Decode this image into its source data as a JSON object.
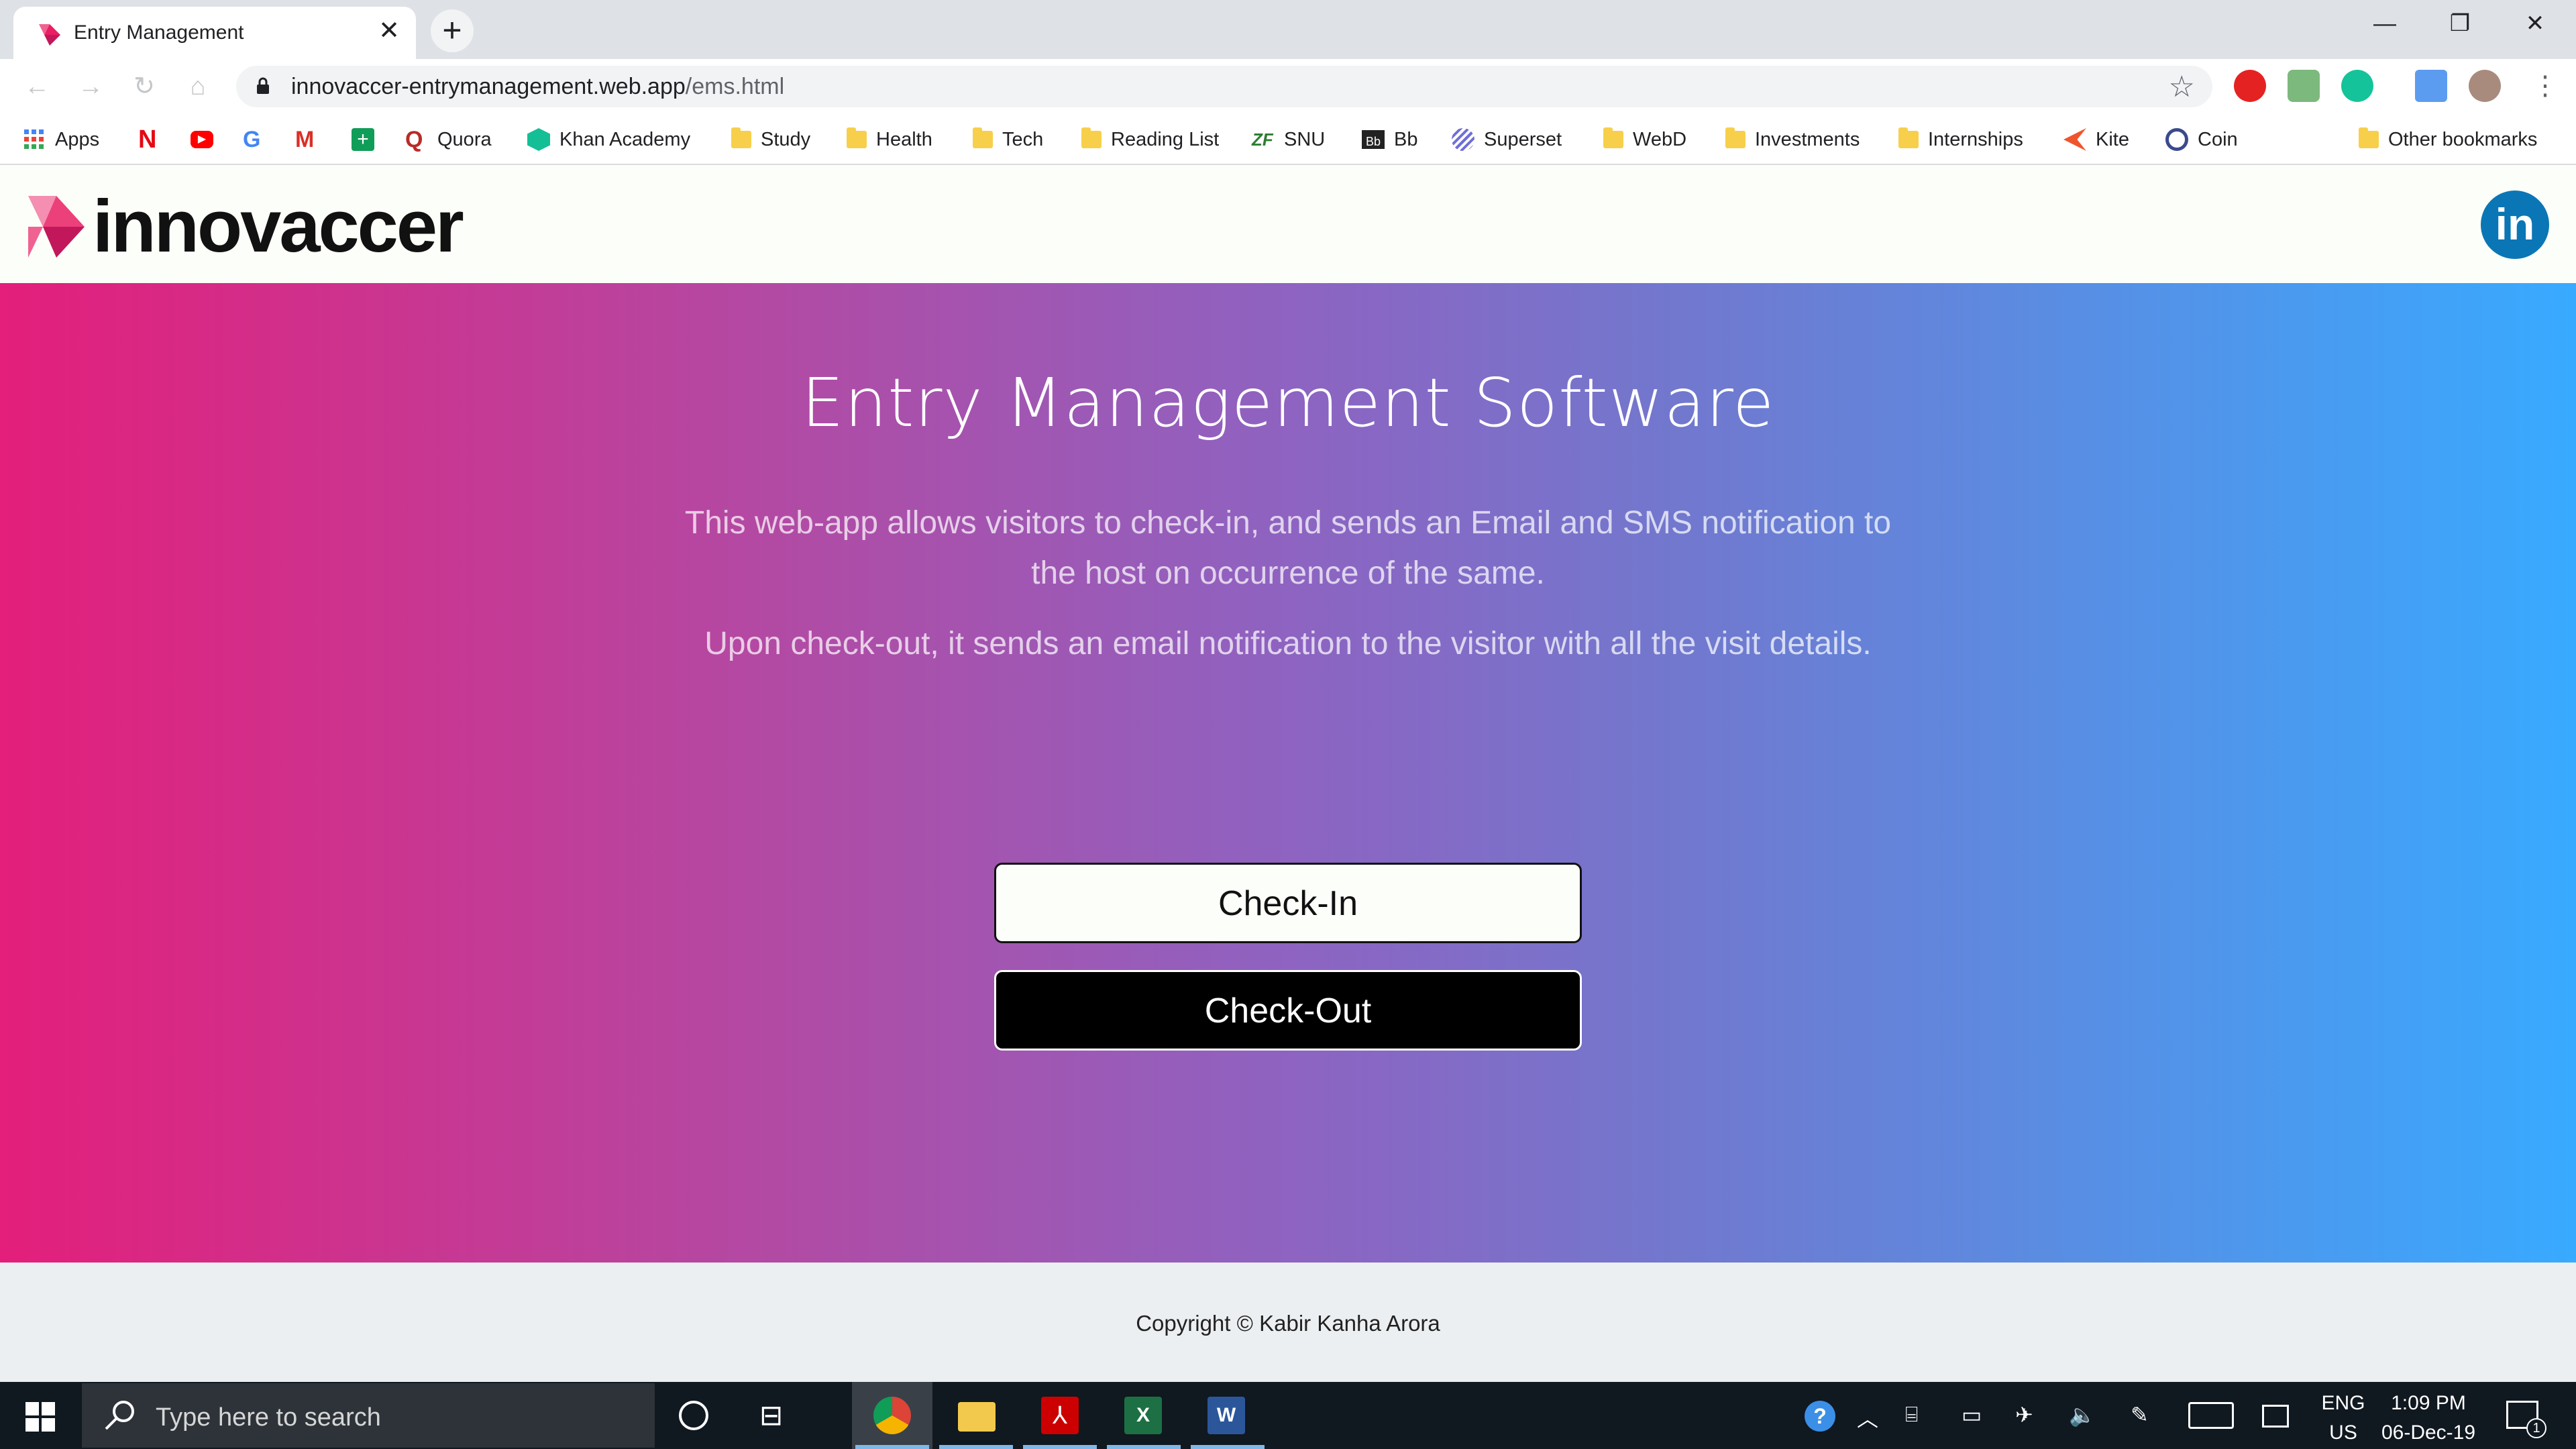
{
  "browser": {
    "tab_title": "Entry Management",
    "url_host": "innovaccer-entrymanagement.web.app",
    "url_path": "/ems.html"
  },
  "bookmarks": [
    {
      "label": "Apps",
      "icon": "apps-grid-icon"
    },
    {
      "label": "",
      "icon": "netflix-icon"
    },
    {
      "label": "",
      "icon": "youtube-icon"
    },
    {
      "label": "",
      "icon": "google-icon"
    },
    {
      "label": "",
      "icon": "gmail-icon"
    },
    {
      "label": "",
      "icon": "sheets-icon"
    },
    {
      "label": "Quora",
      "icon": "quora-icon"
    },
    {
      "label": "Khan Academy",
      "icon": "khan-academy-icon"
    },
    {
      "label": "Study",
      "icon": "folder-icon"
    },
    {
      "label": "Health",
      "icon": "folder-icon"
    },
    {
      "label": "Tech",
      "icon": "folder-icon"
    },
    {
      "label": "Reading List",
      "icon": "folder-icon"
    },
    {
      "label": "SNU",
      "icon": "snu-icon"
    },
    {
      "label": "Bb",
      "icon": "blackboard-icon"
    },
    {
      "label": "Superset",
      "icon": "superset-icon"
    },
    {
      "label": "WebD",
      "icon": "folder-icon"
    },
    {
      "label": "Investments",
      "icon": "folder-icon"
    },
    {
      "label": "Internships",
      "icon": "folder-icon"
    },
    {
      "label": "Kite",
      "icon": "kite-icon"
    },
    {
      "label": "Coin",
      "icon": "coin-icon"
    }
  ],
  "other_bookmarks": "Other bookmarks",
  "site": {
    "logo_text": "innovaccer",
    "linkedin_label": "in",
    "title": "Entry Management Software",
    "description_1": "This web-app allows visitors to check-in, and sends an Email and SMS notification to the host on occurrence of the same.",
    "description_2": "Upon check-out, it sends an email notification to the visitor with all the visit details.",
    "checkin_label": "Check-In",
    "checkout_label": "Check-Out",
    "copyright": "Copyright © Kabir Kanha Arora"
  },
  "taskbar": {
    "search_placeholder": "Type here to search",
    "lang_top": "ENG",
    "lang_bottom": "US",
    "time": "1:09 PM",
    "date": "06-Dec-19",
    "notification_count": "1"
  },
  "colors": {
    "gradient_start": "#e31f7b",
    "gradient_end": "#38aaff",
    "linkedin": "#0b76b5"
  }
}
